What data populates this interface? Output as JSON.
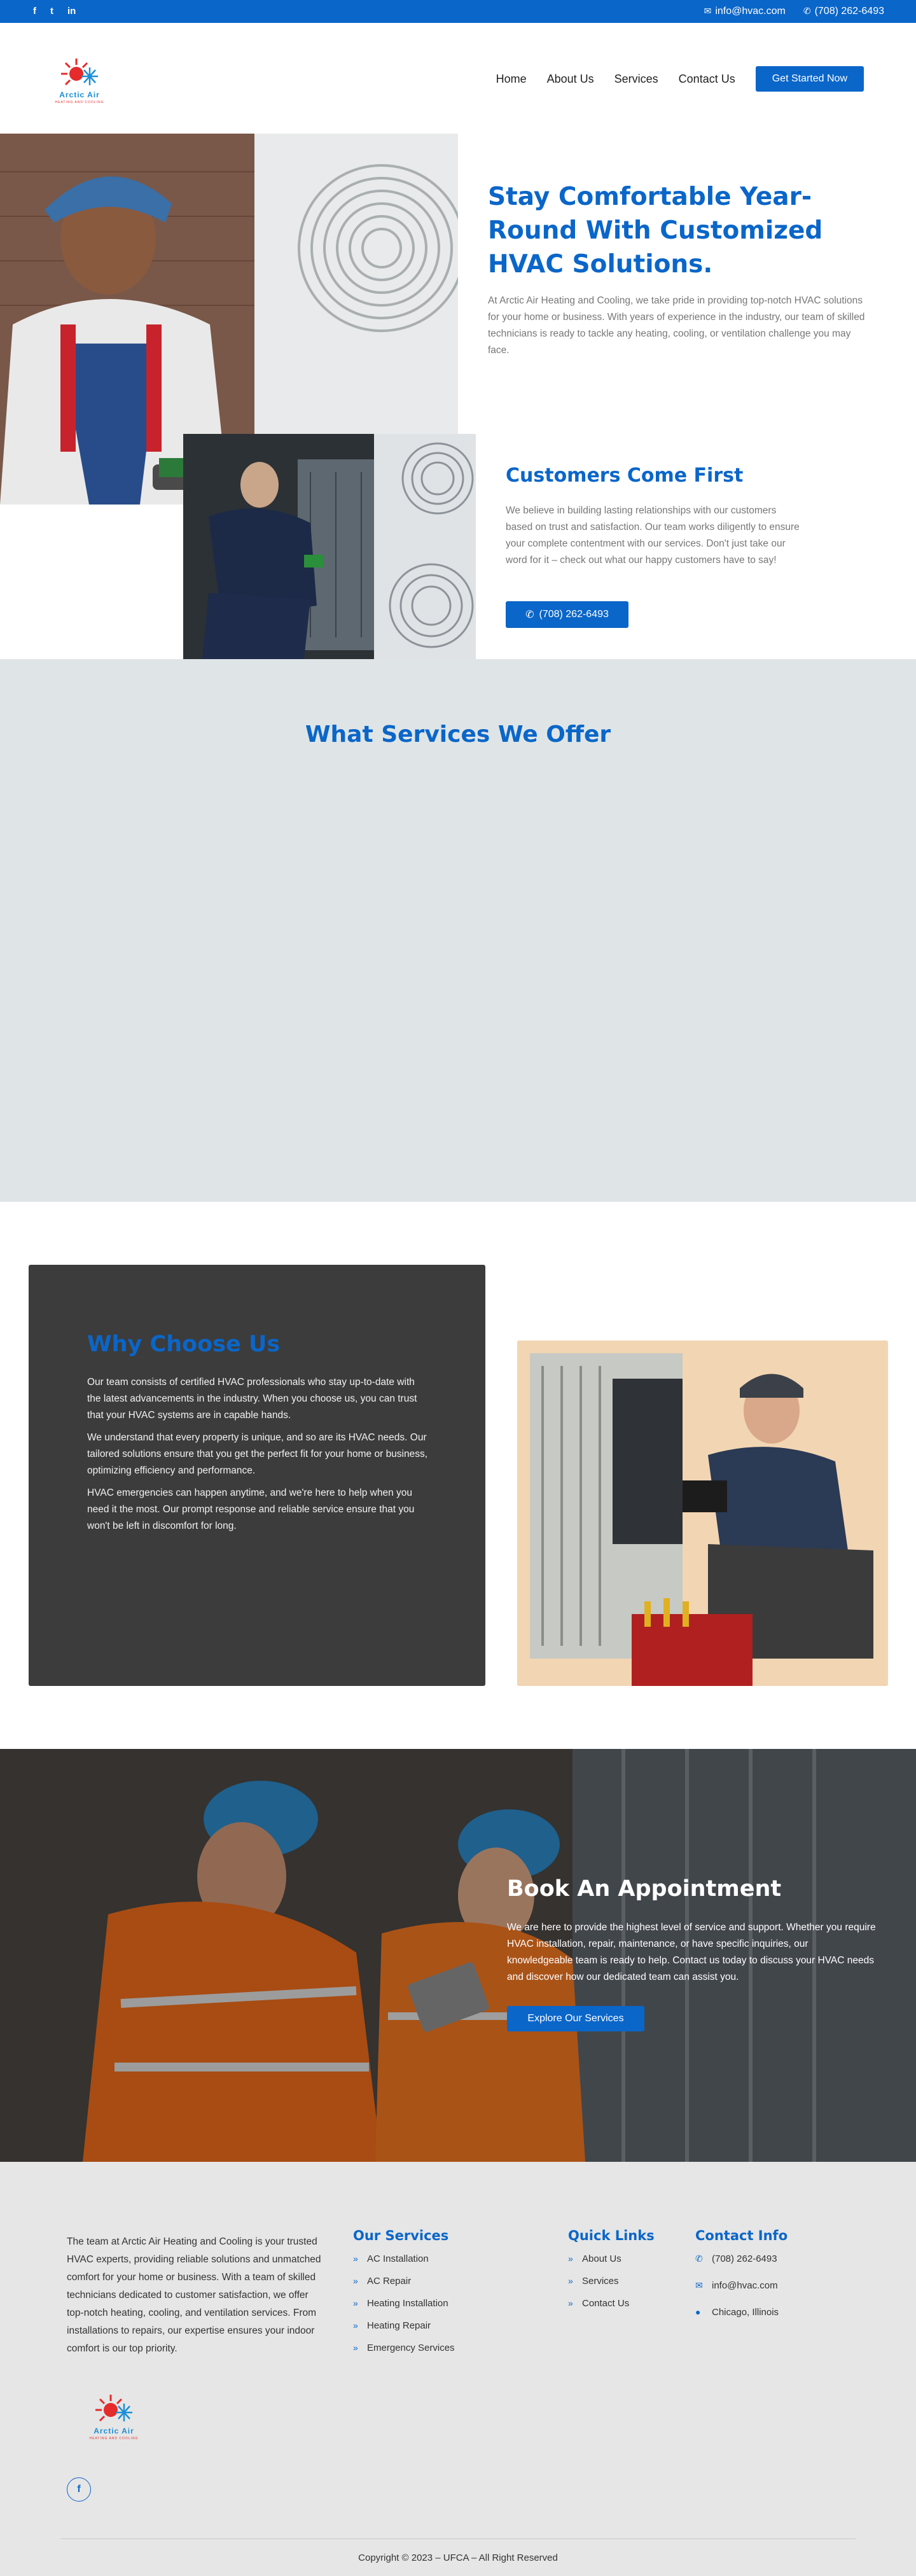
{
  "topbar": {
    "social": [
      "f",
      "t",
      "in"
    ],
    "email": "info@hvac.com",
    "phone": "(708) 262-6493"
  },
  "brand": {
    "logo_text": "Arctic Air",
    "logo_subtext": "HEATING AND COOLING",
    "accent": "#0a66c9"
  },
  "nav": {
    "items": [
      "Home",
      "About Us",
      "Services",
      "Contact Us"
    ],
    "cta": "Get Started Now"
  },
  "hero": {
    "title": "Stay Comfortable Year-Round With Customized HVAC Solutions.",
    "text": "At Arctic Air Heating and Cooling, we take pride in providing top-notch HVAC solutions for your home or business. With years of experience in the industry, our team of skilled technicians is ready to tackle any heating, cooling, or ventilation challenge you may face."
  },
  "customers": {
    "title": "Customers Come First",
    "text": "We believe in building lasting relationships with our customers based on trust and satisfaction. Our team works diligently to ensure your complete contentment with our services. Don't just take our word for it – check out what our happy customers have to say!",
    "phone_button": "(708) 262-6493"
  },
  "services": {
    "title": "What Services We Offer"
  },
  "why": {
    "title": "Why Choose Us",
    "paragraphs": [
      "Our team consists of certified HVAC professionals who stay up-to-date with the latest advancements in the industry. When you choose us, you can trust that your HVAC systems are in capable hands.",
      "We understand that every property is unique, and so are its HVAC needs. Our tailored solutions ensure that you get the perfect fit for your home or business, optimizing efficiency and performance.",
      "HVAC emergencies can happen anytime, and we're here to help when you need it the most. Our prompt response and reliable service ensure that you won't be left in discomfort for long."
    ]
  },
  "appointment": {
    "title": "Book An Appointment",
    "text": "We are here to provide the highest level of service and support. Whether you require HVAC installation, repair, maintenance, or have specific inquiries, our knowledgeable team is ready to help. Contact us today to discuss your HVAC needs and discover how our dedicated team can assist you.",
    "button": "Explore Our Services"
  },
  "footer": {
    "about": "The team at Arctic Air Heating and Cooling is your trusted HVAC experts, providing reliable solutions and unmatched comfort for your home or business. With a team of skilled technicians dedicated to customer satisfaction, we offer top-notch heating, cooling, and ventilation services. From installations to repairs, our expertise ensures your indoor comfort is our top priority.",
    "facebook": "f",
    "services_title": "Our Services",
    "services": [
      "AC Installation",
      "AC Repair",
      "Heating Installation",
      "Heating Repair",
      "Emergency Services"
    ],
    "links_title": "Quick Links",
    "links": [
      "About Us",
      "Services",
      "Contact Us"
    ],
    "contact_title": "Contact Info",
    "contact": {
      "phone": "(708) 262-6493",
      "email": "info@hvac.com",
      "location": "Chicago, Illinois"
    },
    "copyright": "Copyright © 2023 – UFCA – All Right Reserved"
  }
}
